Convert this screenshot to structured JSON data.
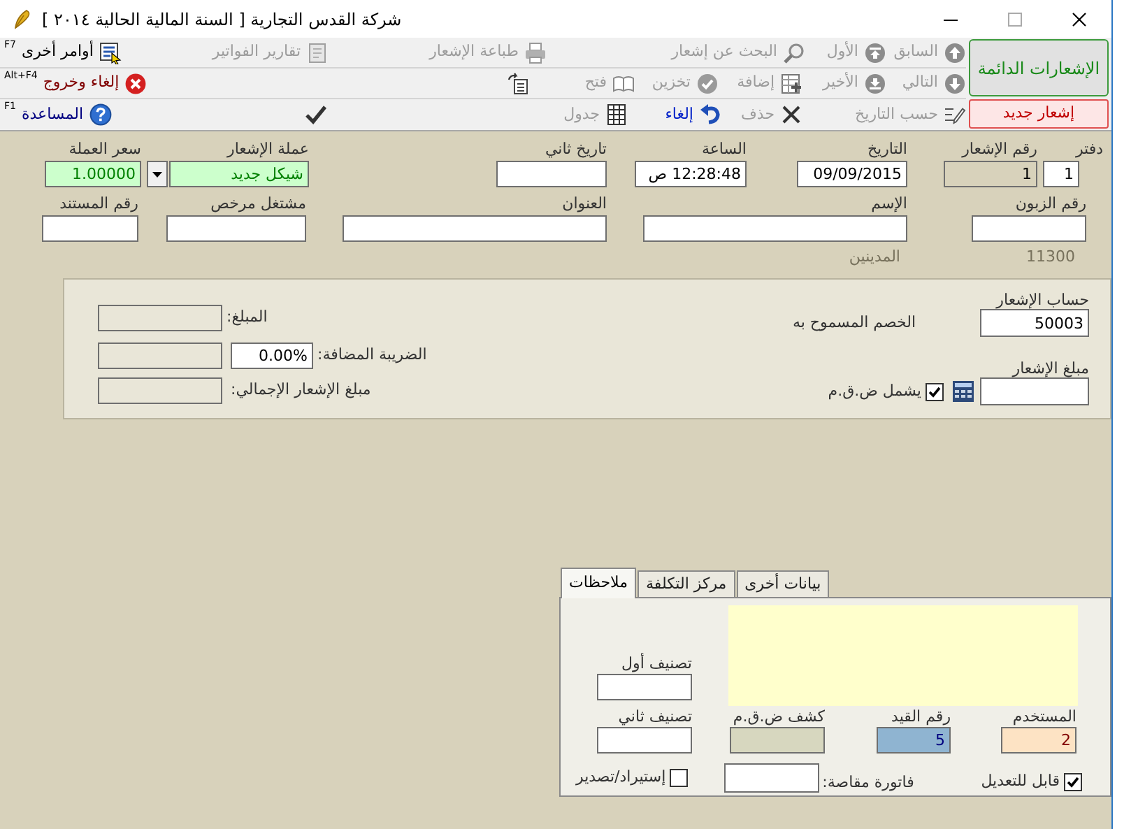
{
  "window": {
    "title": "شركة القدس التجارية [ السنة المالية الحالية ٢٠١٤ ]"
  },
  "toolbar": {
    "side_button": {
      "label": "الإشعارات الدائمة"
    },
    "new_button": {
      "label": "إشعار جديد"
    },
    "row_1": [
      {
        "kind": "up",
        "label": "السابق",
        "disabled": true
      },
      {
        "kind": "top",
        "label": "الأول",
        "disabled": true
      },
      {
        "kind": "search",
        "label": "البحث عن إشعار",
        "disabled": true
      },
      {
        "kind": "print",
        "label": "طباعة الإشعار",
        "disabled": true
      },
      {
        "kind": "report",
        "label": "تقارير الفواتير",
        "disabled": true
      },
      {
        "kind": "commands",
        "label": "أوامر أخرى",
        "shortcut": "F7",
        "disabled": false
      }
    ],
    "row_2": [
      {
        "kind": "down",
        "label": "التالي",
        "disabled": true
      },
      {
        "kind": "bottom",
        "label": "الأخير",
        "disabled": true
      },
      {
        "kind": "add",
        "label": "إضافة",
        "disabled": true
      },
      {
        "kind": "save",
        "label": "تخزين",
        "disabled": true
      },
      {
        "kind": "open",
        "label": "فتح",
        "disabled": true
      },
      {
        "kind": "doc"
      },
      {
        "kind": "exit",
        "label": "إلغاء وخروج",
        "shortcut": "Alt+F4",
        "disabled": false
      }
    ],
    "row_3": [
      {
        "kind": "date",
        "label": "حسب التاريخ",
        "disabled": true
      },
      {
        "kind": "delete",
        "label": "حذف",
        "disabled": true
      },
      {
        "kind": "undo",
        "label": "إلغاء",
        "disabled": false
      },
      {
        "kind": "grid",
        "label": "جدول",
        "disabled": true
      },
      {
        "kind": "check"
      },
      {
        "kind": "help",
        "label": "المساعدة",
        "shortcut": "F1",
        "disabled": false
      }
    ]
  },
  "header_rows": [
    [
      {
        "kind": "text",
        "label": "دفتر",
        "value": "1"
      },
      {
        "kind": "readonly",
        "label": "رقم الإشعار",
        "value": "1"
      },
      {
        "kind": "text",
        "label": "التاريخ",
        "value": "09/09/2015"
      },
      {
        "kind": "text",
        "label": "الساعة",
        "value": "12:28:48 ص"
      },
      {
        "kind": "text",
        "label": "تاريخ ثاني"
      },
      {
        "kind": "dropdown",
        "label": "عملة الإشعار",
        "value": "شيكل جديد"
      },
      {
        "kind": "highlight",
        "label": "سعر العملة",
        "value": "1.00000"
      }
    ],
    [
      {
        "kind": "text",
        "label": "رقم الزبون"
      },
      {
        "kind": "text",
        "label": "الإسم"
      },
      {
        "kind": "text",
        "label": "العنوان"
      },
      {
        "kind": "text",
        "label": "مشتغل مرخص"
      },
      {
        "kind": "text",
        "label": "رقم المستند"
      }
    ]
  ],
  "account": {
    "code": "11300",
    "name": "المدينين"
  },
  "amount_panel": {
    "account": {
      "label": "حساب الإشعار",
      "value": "50003"
    },
    "discount_label": "الخصم المسموح به",
    "amount": {
      "label": "مبلغ الإشعار"
    },
    "includes_vat": {
      "label": "يشمل ض.ق.م",
      "checked": true
    },
    "totals": [
      {
        "label": "المبلغ:"
      },
      {
        "label": "الضريبة المضافة:",
        "rate": "0.00%"
      },
      {
        "label": "مبلغ الإشعار الإجمالي:"
      }
    ]
  },
  "tabs": [
    {
      "label": "بيانات أخرى",
      "selected": false
    },
    {
      "label": "مركز التكلفة",
      "selected": false
    },
    {
      "label": "ملاحظات",
      "selected": true
    }
  ],
  "notes_tab": {
    "class_1": {
      "label": "تصنيف أول"
    },
    "class_2": {
      "label": "تصنيف ثاني"
    },
    "vat_statement": {
      "label": "كشف ض.ق.م"
    },
    "entry_number": {
      "label": "رقم القيد",
      "value": "5"
    },
    "user": {
      "label": "المستخدم",
      "value": "2"
    },
    "import_export": {
      "label": "إستيراد/تصدير",
      "checked": false
    },
    "offset_invoice": {
      "label": "فاتورة مقاصة:"
    },
    "editable": {
      "label": "قابل للتعديل",
      "checked": true
    }
  }
}
